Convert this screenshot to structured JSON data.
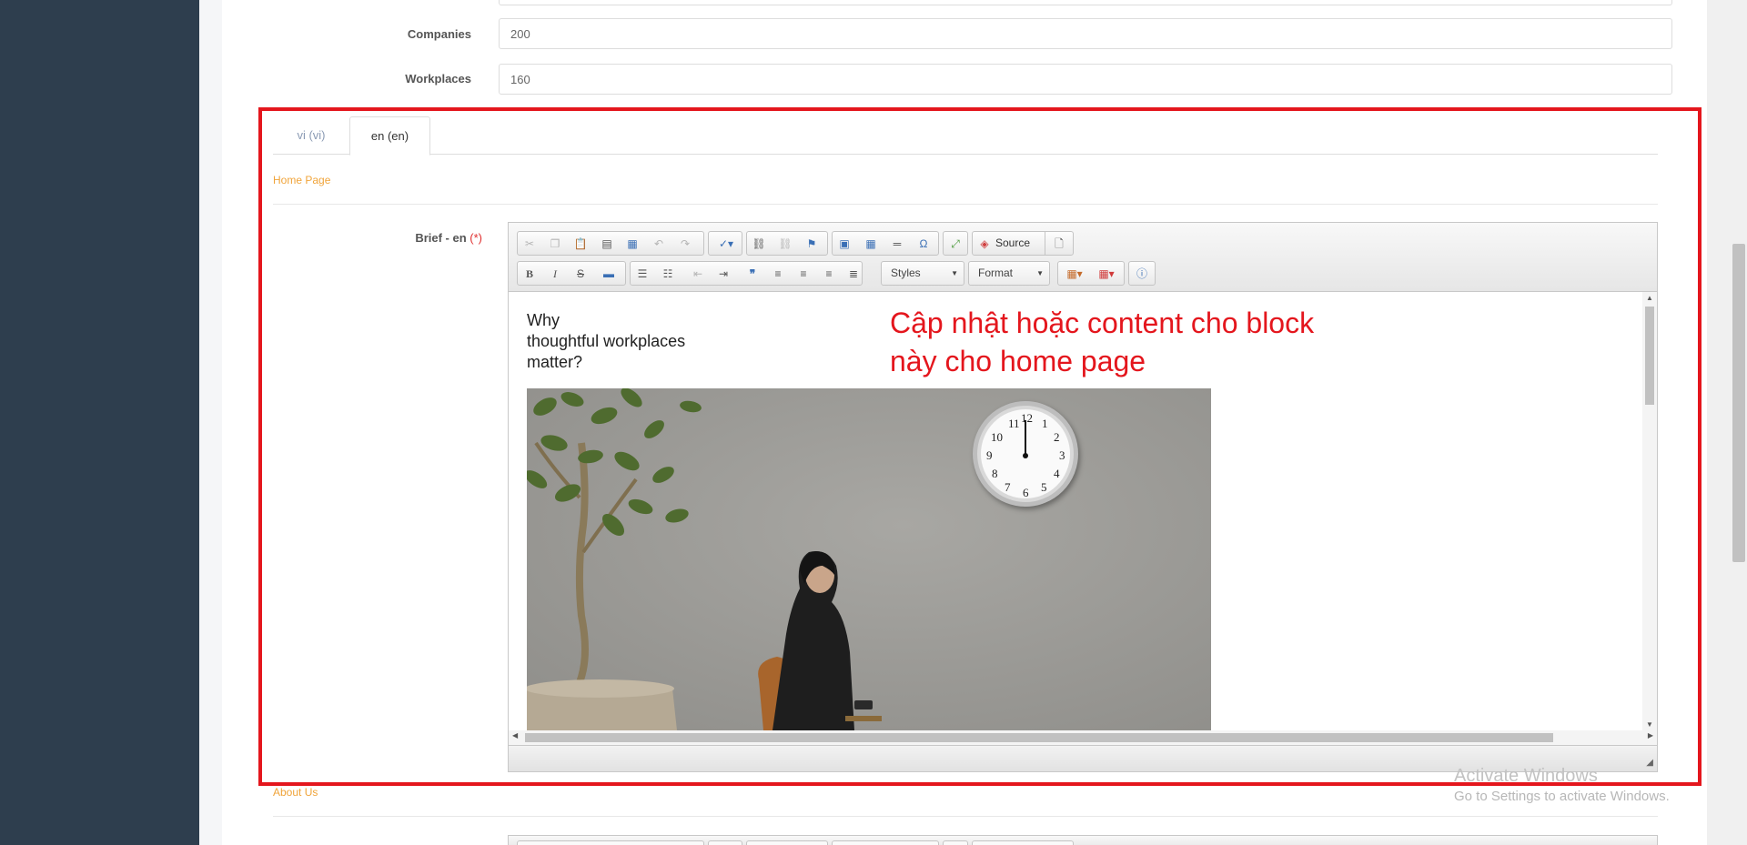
{
  "form": {
    "companies_label": "Companies",
    "companies_value": "200",
    "workplaces_label": "Workplaces",
    "workplaces_value": "160"
  },
  "tabs": [
    {
      "label": "vi (vi)",
      "active": false
    },
    {
      "label": "en (en)",
      "active": true
    }
  ],
  "sections": {
    "home_page": "Home Page",
    "about_us": "About Us"
  },
  "brief": {
    "label": "Brief - en",
    "required_marker": "(*)"
  },
  "editor": {
    "toolbar_row1": [
      "cut-icon",
      "copy-icon",
      "paste-icon",
      "paste-text-icon",
      "paste-word-icon",
      "undo-icon",
      "redo-icon",
      "spellcheck-icon",
      "link-icon",
      "unlink-icon",
      "anchor-icon",
      "image-icon",
      "table-icon",
      "horizontal-rule-icon",
      "special-char-icon",
      "maximize-icon",
      "source-icon",
      "preview-icon"
    ],
    "source_label": "Source",
    "toolbar_row2": [
      "bold-icon",
      "italic-icon",
      "strike-icon",
      "remove-format-icon",
      "numbered-list-icon",
      "bullet-list-icon",
      "outdent-icon",
      "indent-icon",
      "blockquote-icon",
      "align-left-icon",
      "align-center-icon",
      "align-right-icon",
      "justify-icon",
      "text-color-icon",
      "bg-color-icon",
      "about-icon"
    ],
    "styles_label": "Styles",
    "format_label": "Format",
    "content_lines": [
      "Why",
      "thoughtful workplaces",
      "matter?"
    ]
  },
  "annotation": {
    "text": "Cập nhật hoặc content cho block này cho home page",
    "color": "#e4161d"
  },
  "watermark": {
    "line1": "Activate Windows",
    "line2": "Go to Settings to activate Windows."
  },
  "clock": {
    "numbers": [
      "11",
      "12",
      "1",
      "2",
      "3",
      "4",
      "5",
      "6",
      "7",
      "8",
      "9",
      "10"
    ]
  }
}
